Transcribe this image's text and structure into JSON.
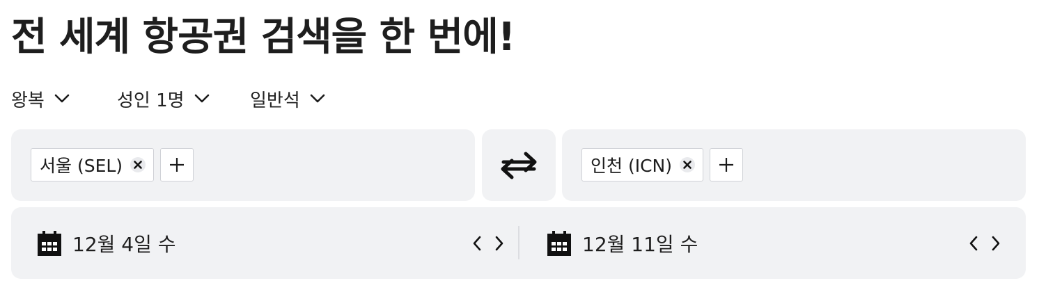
{
  "header": {
    "title": "전 세계 항공권 검색을 한 번에!"
  },
  "options": {
    "trip_type": "왕복",
    "passengers": "성인 1명",
    "cabin_class": "일반석"
  },
  "origin": {
    "chip_label": "서울 (SEL)"
  },
  "destination": {
    "chip_label": "인천 (ICN)"
  },
  "dates": {
    "depart": "12월 4일 수",
    "return": "12월 11일 수"
  },
  "icons": {
    "chevron": "chevron-down-icon",
    "remove": "close-icon",
    "add": "plus-icon",
    "swap": "swap-arrows-icon",
    "calendar": "calendar-icon",
    "prev": "chevron-left-icon",
    "next": "chevron-right-icon"
  }
}
